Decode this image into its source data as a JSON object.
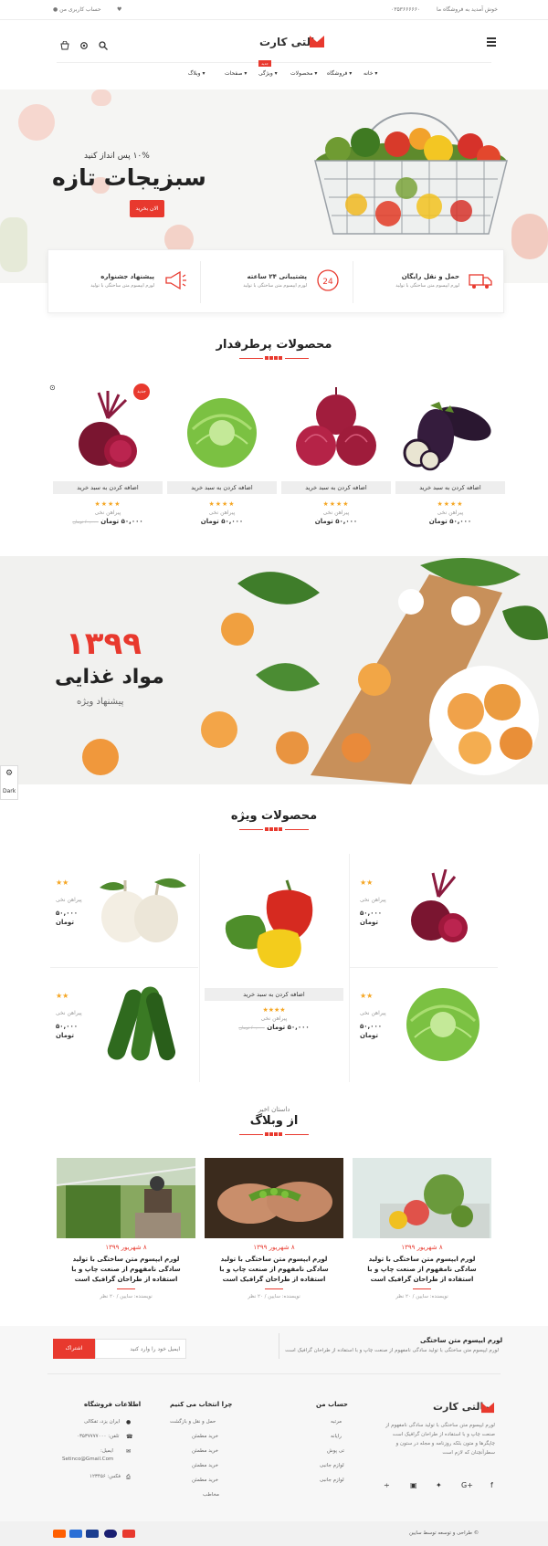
{
  "topbar": {
    "welcome": "خوش آمدید به فروشگاه ما",
    "phone": "۰۳۵۳۶۶۶۶۶۰",
    "account": "حساب کاربری من"
  },
  "header": {
    "logo": "مالتی کارت",
    "nav": [
      "خانه",
      "فروشگاه",
      "محصولات",
      "ویژگی",
      "صفحات",
      "وبلاگ"
    ],
    "nav_badge": "جدید"
  },
  "hero": {
    "subtitle": "۱۰% پس انداز کنید",
    "title": "سبزیجات تازه",
    "button": "الان بخرید"
  },
  "features": [
    {
      "title": "حمل و نقل رایگان",
      "desc": "لورم ایپسوم متن ساختگی با تولید"
    },
    {
      "title": "پشتیبانی ۲۴ ساعته",
      "desc": "لورم ایپسوم متن ساختگی با تولید"
    },
    {
      "title": "پیشنهاد جشنواره",
      "desc": "لورم ایپسوم متن ساختگی با تولید"
    }
  ],
  "bestsellers": {
    "title": "محصولات پرطرفدار",
    "products": [
      {
        "name": "پیراهن نخی",
        "add": "اضافه کردن به سبد خرید",
        "price": "۵۰,۰۰۰ تومان",
        "old": ""
      },
      {
        "name": "پیراهن نخی",
        "add": "اضافه کردن به سبد خرید",
        "price": "۵۰,۰۰۰ تومان",
        "old": ""
      },
      {
        "name": "پیراهن نخی",
        "add": "اضافه کردن به سبد خرید",
        "price": "۵۰,۰۰۰ تومان",
        "old": ""
      },
      {
        "name": "پیراهن نخی",
        "add": "اضافه کردن به سبد خرید",
        "price": "۵۰,۰۰۰ تومان",
        "old": "۶۰,۰۰۰ تومان"
      }
    ],
    "badge": "جدید",
    "stars": "★★★★"
  },
  "banner": {
    "number": "۱۳۹۹",
    "title": "مواد غذایی",
    "subtitle": "پیشنهاد ویژه"
  },
  "sidewidget": {
    "label": "Dark"
  },
  "special": {
    "title": "محصولات ویژه",
    "items": [
      {
        "name": "پیراهن نخی",
        "price": "۵۰,۰۰۰",
        "unit": "تومان"
      },
      {
        "name": "پیراهن نخی",
        "price": "۵۰,۰۰۰",
        "unit": "تومان"
      },
      {
        "name": "پیراهن نخی",
        "price": "۵۰,۰۰۰",
        "unit": "تومان"
      },
      {
        "name": "پیراهن نخی",
        "price": "۵۰,۰۰۰",
        "unit": "تومان"
      }
    ],
    "center": {
      "add": "اضافه کردن به سبد خرید",
      "name": "پیراهن نخی",
      "price": "۵۰,۰۰۰ تومان",
      "old": "۶۰,۰۰۰ تومان"
    },
    "stars2": "★★",
    "stars4": "★★★★"
  },
  "blog": {
    "subtitle": "داستان اخیر",
    "title": "از وبلاگ",
    "posts": [
      {
        "date": "۸ شهریور ۱۳۹۹",
        "title": "لورم ایپسوم متن ساختگی با تولید سادگی نامفهوم از صنعت چاپ و با استفاده از طراحان گرافیک است",
        "meta": "نویسنده: سایین / ۲۰ نظر"
      },
      {
        "date": "۸ شهریور ۱۳۹۹",
        "title": "لورم ایپسوم متن ساختگی با تولید سادگی نامفهوم از صنعت چاپ و با استفاده از طراحان گرافیک است",
        "meta": "نویسنده: سایین / ۲۰ نظر"
      },
      {
        "date": "۸ شهریور ۱۳۹۹",
        "title": "لورم ایپسوم متن ساختگی با تولید سادگی نامفهوم از صنعت چاپ و با استفاده از طراحان گرافیک است",
        "meta": "نویسنده: سایین / ۲۰ نظر"
      }
    ]
  },
  "newsletter": {
    "title": "لورم ایپسوم متن ساختگی",
    "desc": "لورم ایپسوم متن ساختگی با تولید سادگی نامفهوم از صنعت چاپ و با استفاده از طراحان گرافیک است",
    "placeholder": "ایمیل خود را وارد کنید",
    "button": "اشتراک"
  },
  "footer": {
    "logo": "مالتی کارت",
    "about": "لورم ایپسوم متن ساختگی با تولید سادگی نامفهوم از صنعت چاپ و با استفاده از طراحان گرافیک است چاپگرها و متون بلکه روزنامه و مجله در ستون و سطرآنچنان که لازم است",
    "col_account": {
      "title": "حساب من",
      "links": [
        "مرتبه",
        "رایانه",
        "تی پوش",
        "لوازم جانبی",
        "لوازم جانبی"
      ]
    },
    "col_why": {
      "title": "چرا انتخاب می کنیم",
      "links": [
        "حمل و نقل و بازگشت",
        "خرید مطمئن",
        "خرید مطمئن",
        "خرید مطمئن",
        "خرید مطمئن",
        "مخاطب"
      ]
    },
    "col_info": {
      "title": "اطلاعات فروشگاه",
      "address": "ایران یزد، تفکالی",
      "phone": "تلفن: ۰۳۵۳۷۷۷۷۰۰۰",
      "email_label": "ایمیل:",
      "email": "Setinco@Gmail.Com",
      "fax": "فکس: ۱۲۳۴۵۶"
    },
    "copyright": "© طراحی و توسعه توسط سایین"
  },
  "colors": {
    "accent": "#e8392e",
    "star": "#f5a623"
  }
}
